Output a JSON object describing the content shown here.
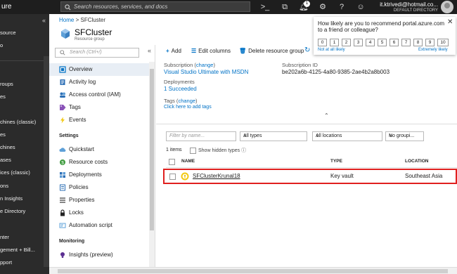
{
  "topbar": {
    "brand": "ure",
    "search_placeholder": "Search resources, services, and docs",
    "notification_count": "1",
    "user_email": "it.ktrivedi@hotmail.co...",
    "user_directory": "DEFAULT DIRECTORY"
  },
  "leftnav": {
    "collapse": "«",
    "items": [
      "source",
      "o",
      "roups",
      "es",
      "chines (classic)",
      "es",
      "chines",
      "ases",
      "ices (classic)",
      "ons",
      "n Insights",
      "e Directory",
      "nter",
      "gement + Bill...",
      "pport"
    ]
  },
  "breadcrumb": {
    "home": "Home",
    "sep": ">",
    "current": "SFCluster"
  },
  "resource": {
    "title": "SFCluster",
    "subtitle": "Resource group"
  },
  "resmenu": {
    "search_placeholder": "Search (Ctrl+/)",
    "collapse": "«",
    "items": [
      "Overview",
      "Activity log",
      "Access control (IAM)",
      "Tags",
      "Events"
    ],
    "settings_header": "Settings",
    "settings_items": [
      "Quickstart",
      "Resource costs",
      "Deployments",
      "Policies",
      "Properties",
      "Locks",
      "Automation script"
    ],
    "monitoring_header": "Monitoring",
    "monitoring_items": [
      "Insights (preview)"
    ]
  },
  "toolbar": {
    "add": "Add",
    "edit_columns": "Edit columns",
    "delete": "Delete resource group",
    "refresh": "↻"
  },
  "essentials": {
    "subscription_label": "Subscription",
    "subscription_change": "change",
    "subscription_value": "Visual Studio Ultimate with MSDN",
    "subscription_id_label": "Subscription ID",
    "subscription_id_value": "be202a6b-4125-4a80-9385-2ae4b2a8b003",
    "deployments_label": "Deployments",
    "deployments_value": "1 Succeeded",
    "tags_label": "Tags",
    "tags_change": "change",
    "tags_add": "Click here to add tags"
  },
  "filters": {
    "name_placeholder": "Filter by name...",
    "types": "All types",
    "locations": "All locations",
    "grouping": "No groupi..."
  },
  "list": {
    "count": "1 items",
    "show_hidden": "Show hidden types",
    "columns": [
      "NAME",
      "TYPE",
      "LOCATION"
    ],
    "rows": [
      {
        "name": "SFClusterKrunal18",
        "type": "Key vault",
        "location": "Southeast Asia"
      }
    ]
  },
  "survey": {
    "question": "How likely are you to recommend portal.azure.com to a friend or colleague?",
    "scores": [
      "0",
      "1",
      "2",
      "3",
      "4",
      "5",
      "6",
      "7",
      "8",
      "9",
      "10"
    ],
    "low_label": "Not at all likely",
    "high_label": "Extremely likely",
    "close": "✕"
  },
  "colors": {
    "accent": "#0072c6",
    "highlight": "#e0201f",
    "topbar": "#1e1e1e",
    "nav": "#2b2b2b"
  }
}
